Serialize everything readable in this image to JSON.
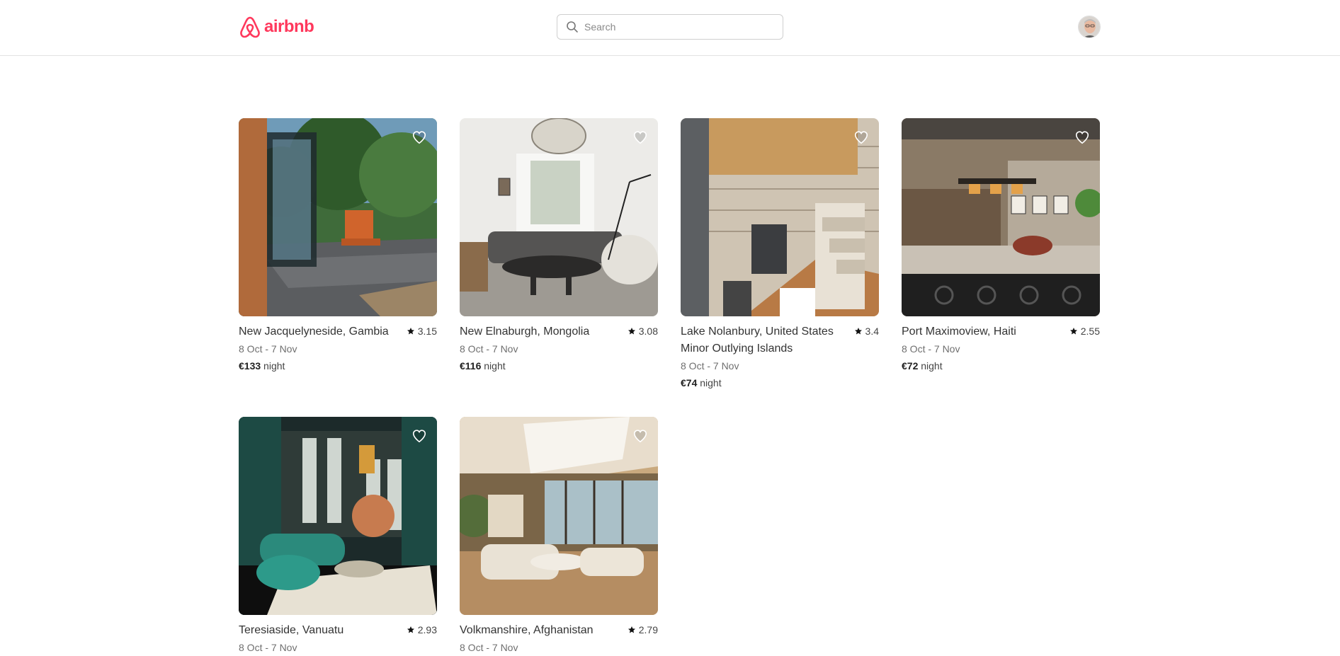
{
  "header": {
    "brand": "airbnb",
    "search_placeholder": "Search",
    "brand_color": "#ff385c"
  },
  "listings": [
    {
      "location": "New Jacquelyneside, Gambia",
      "rating": "3.15",
      "dates": "8 Oct - 7 Nov",
      "price": "€133",
      "unit": "night"
    },
    {
      "location": "New Elnaburgh, Mongolia",
      "rating": "3.08",
      "dates": "8 Oct - 7 Nov",
      "price": "€116",
      "unit": "night"
    },
    {
      "location": "Lake Nolanbury, United States Minor Outlying Islands",
      "rating": "3.4",
      "dates": "8 Oct - 7 Nov",
      "price": "€74",
      "unit": "night"
    },
    {
      "location": "Port Maximoview, Haiti",
      "rating": "2.55",
      "dates": "8 Oct - 7 Nov",
      "price": "€72",
      "unit": "night"
    },
    {
      "location": "Teresiaside, Vanuatu",
      "rating": "2.93",
      "dates": "8 Oct - 7 Nov",
      "price": "",
      "unit": ""
    },
    {
      "location": "Volkmanshire, Afghanistan",
      "rating": "2.79",
      "dates": "8 Oct - 7 Nov",
      "price": "",
      "unit": ""
    }
  ],
  "icons": {
    "logo": "airbnb-logo-icon",
    "search": "search-icon",
    "heart": "heart-icon",
    "star": "star-icon"
  }
}
